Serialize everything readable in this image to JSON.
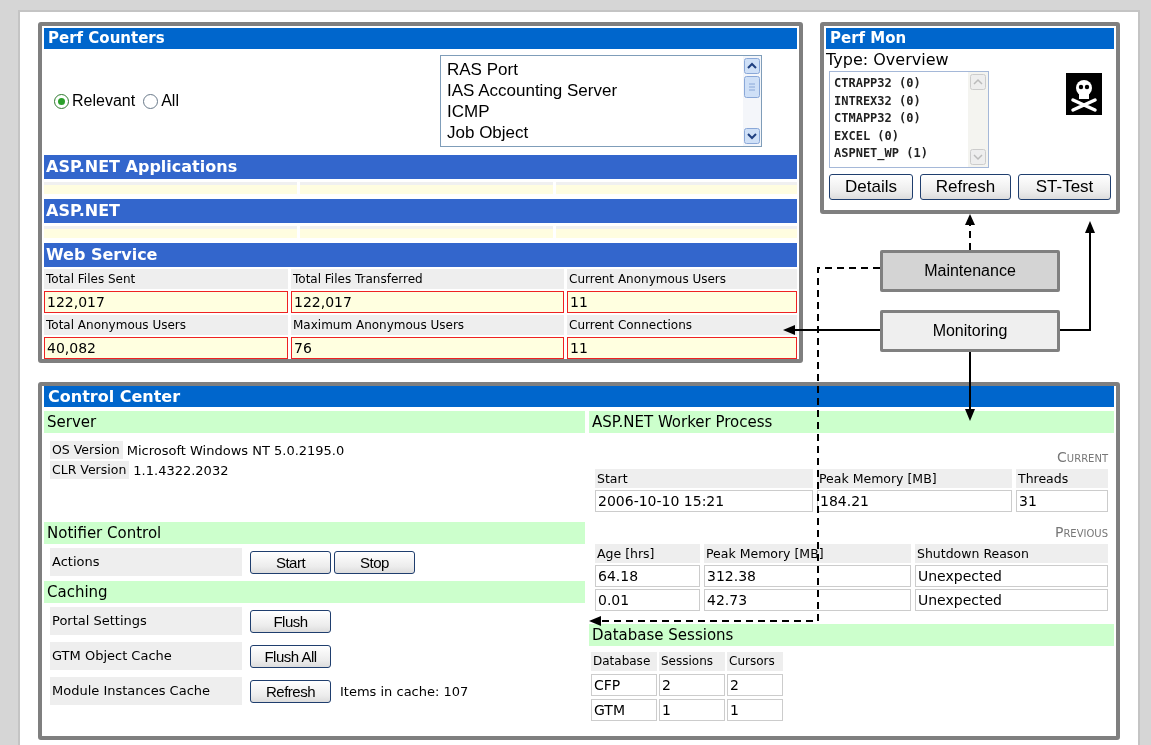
{
  "perf_counters": {
    "title": "Perf Counters",
    "filter": [
      {
        "label": "Relevant",
        "selected": true
      },
      {
        "label": "All",
        "selected": false
      }
    ],
    "counter_list": [
      "RAS Port",
      "IAS Accounting Server",
      "ICMP",
      "Job Object"
    ],
    "sections": [
      {
        "title": "ASP.NET Applications"
      },
      {
        "title": "ASP.NET"
      }
    ],
    "web_service": {
      "title": "Web Service",
      "fields": [
        {
          "label": "Total Files Sent",
          "value": "122,017"
        },
        {
          "label": "Total Files Transferred",
          "value": "122,017"
        },
        {
          "label": "Current Anonymous Users",
          "value": "11"
        },
        {
          "label": "Total Anonymous Users",
          "value": "40,082"
        },
        {
          "label": "Maximum Anonymous Users",
          "value": "76"
        },
        {
          "label": "Current Connections",
          "value": "11"
        }
      ]
    }
  },
  "perf_mon": {
    "title": "Perf Mon",
    "type_label": "Type: Overview",
    "processes": [
      "CTRAPP32 (0)",
      "INTREX32 (0)",
      "CTMAPP32 (0)",
      "EXCEL (0)",
      "ASPNET_WP (1)"
    ],
    "buttons": [
      "Details",
      "Refresh",
      "ST-Test"
    ]
  },
  "callouts": [
    {
      "label": "Maintenance",
      "kind": "dashed"
    },
    {
      "label": "Monitoring",
      "kind": "solid"
    }
  ],
  "control_center": {
    "title": "Control Center",
    "server": {
      "title": "Server",
      "rows": [
        {
          "label": "OS Version",
          "value": "Microsoft Windows NT 5.0.2195.0"
        },
        {
          "label": "CLR Version",
          "value": "1.1.4322.2032"
        }
      ]
    },
    "notifier": {
      "title": "Notifier Control",
      "rows": [
        {
          "label": "Actions",
          "buttons": [
            "Start",
            "Stop"
          ]
        }
      ]
    },
    "caching": {
      "title": "Caching",
      "rows": [
        {
          "label": "Portal Settings",
          "buttons": [
            "Flush"
          ]
        },
        {
          "label": "GTM Object Cache",
          "buttons": [
            "Flush All"
          ]
        },
        {
          "label": "Module Instances Cache",
          "buttons": [
            "Refresh"
          ],
          "note": "Items in cache: 107"
        }
      ]
    },
    "worker": {
      "title": "ASP.NET Worker Process",
      "current": {
        "caption": "Current",
        "columns": [
          "Start",
          "Peak Memory [MB]",
          "Threads"
        ],
        "rows": [
          [
            "2006-10-10 15:21",
            "184.21",
            "31"
          ]
        ]
      },
      "previous": {
        "caption": "Previous",
        "columns": [
          "Age [hrs]",
          "Peak Memory [MB]",
          "Shutdown Reason"
        ],
        "rows": [
          [
            "64.18",
            "312.38",
            "Unexpected"
          ],
          [
            "0.01",
            "42.73",
            "Unexpected"
          ]
        ]
      }
    },
    "database_sessions": {
      "title": "Database Sessions",
      "columns": [
        "Database",
        "Sessions",
        "Cursors"
      ],
      "rows": [
        [
          "CFP",
          "2",
          "2"
        ],
        [
          "GTM",
          "1",
          "1"
        ]
      ]
    }
  }
}
